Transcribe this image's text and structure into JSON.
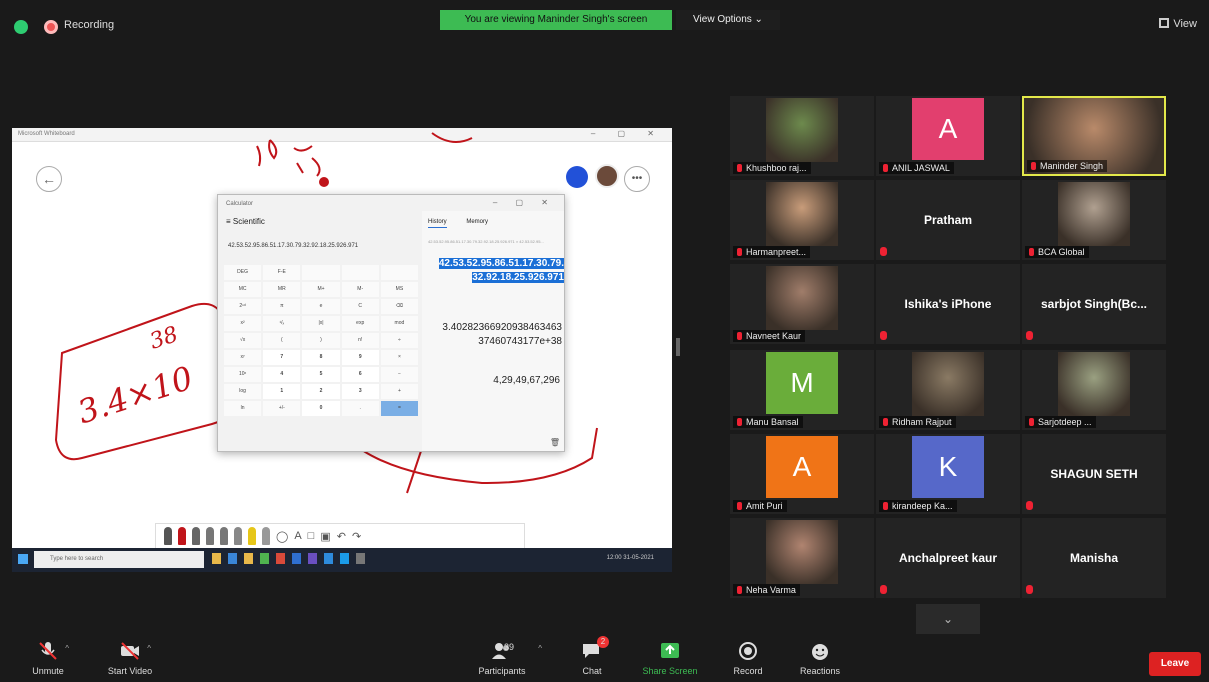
{
  "topbar": {
    "recording": "Recording",
    "viewing_banner": "You are viewing Maninder Singh's screen",
    "view_options": "View Options ⌄",
    "view": "View"
  },
  "shared_screen": {
    "window_title": "Microsoft Whiteboard",
    "handwriting": {
      "expression": "3.4×10",
      "exponent": "38"
    },
    "calculator": {
      "title": "Calculator",
      "mode": "≡  Scientific",
      "expression": "42.53.52.95.86.51.17.30.79.32.92.18.25.926.971",
      "tabs": [
        "History",
        "Memory"
      ],
      "history_small": "42.53.52.95.86.51.17.30.79.32.92.18.25.926.971 × 42.53.52.95...",
      "selected_lines": [
        "42.53.52.95.86.51.17.30.79.",
        "32.92.18.25.926.971"
      ],
      "result_lines": [
        "3.40282366920938463463",
        "37460743177e+38"
      ],
      "result_2": "4,29,49,67,296",
      "keys": [
        [
          "DEG",
          "F-E",
          "",
          "",
          "",
          ""
        ],
        [
          "MC",
          "MR",
          "M+",
          "M-",
          "MS",
          "M˅"
        ],
        [
          "2ⁿᵈ",
          "π",
          "e",
          "C",
          "⌫",
          ""
        ],
        [
          "x²",
          "¹/ₓ",
          "|x|",
          "exp",
          "mod",
          ""
        ],
        [
          "√x",
          "(",
          ")",
          "n!",
          "÷",
          ""
        ],
        [
          "xʸ",
          "7",
          "8",
          "9",
          "×",
          ""
        ],
        [
          "10ˣ",
          "4",
          "5",
          "6",
          "−",
          ""
        ],
        [
          "log",
          "1",
          "2",
          "3",
          "+",
          ""
        ],
        [
          "ln",
          "+/-",
          "0",
          ".",
          "=",
          ""
        ]
      ]
    },
    "taskbar_search": "Type here to search",
    "taskbar_clock": "12:00  31-05-2021"
  },
  "participants": [
    {
      "name": "Khushboo raj...",
      "type": "photo",
      "color": "#6d8a4d"
    },
    {
      "name": "ANIL JASWAL",
      "type": "letter",
      "letter": "A",
      "color": "#e23f6e"
    },
    {
      "name": "Maninder Singh",
      "type": "photo",
      "color": "#b98a6a",
      "active": true
    },
    {
      "name": "Harmanpreet...",
      "type": "photo",
      "color": "#c89c7a"
    },
    {
      "name": "Pratham",
      "type": "name"
    },
    {
      "name": "BCA Global",
      "type": "photo",
      "color": "#b0a090"
    },
    {
      "name": "Navneet Kaur",
      "type": "photo",
      "color": "#a07d6a"
    },
    {
      "name": "Ishika's iPhone",
      "type": "name"
    },
    {
      "name": "sarbjot Singh(Bc...",
      "type": "name"
    },
    {
      "name": "Manu Bansal",
      "type": "letter",
      "letter": "M",
      "color": "#6aad3a"
    },
    {
      "name": "Ridham Rajput",
      "type": "photo",
      "color": "#8a7a64"
    },
    {
      "name": "Sarjotdeep ...",
      "type": "photo",
      "color": "#9aa081"
    },
    {
      "name": "Amit Puri",
      "type": "letter",
      "letter": "A",
      "color": "#f07417"
    },
    {
      "name": "kirandeep Ka...",
      "type": "letter",
      "letter": "K",
      "color": "#5668c9"
    },
    {
      "name": "SHAGUN SETH",
      "type": "name"
    },
    {
      "name": "Neha Varma",
      "type": "photo",
      "color": "#b08470"
    },
    {
      "name": "Anchalpreet kaur",
      "type": "name"
    },
    {
      "name": "Manisha",
      "type": "name"
    }
  ],
  "toolbar": {
    "unmute": "Unmute",
    "start_video": "Start Video",
    "participants": "Participants",
    "participants_count": "39",
    "chat": "Chat",
    "chat_badge": "2",
    "share_screen": "Share Screen",
    "record": "Record",
    "reactions": "Reactions",
    "leave": "Leave"
  }
}
